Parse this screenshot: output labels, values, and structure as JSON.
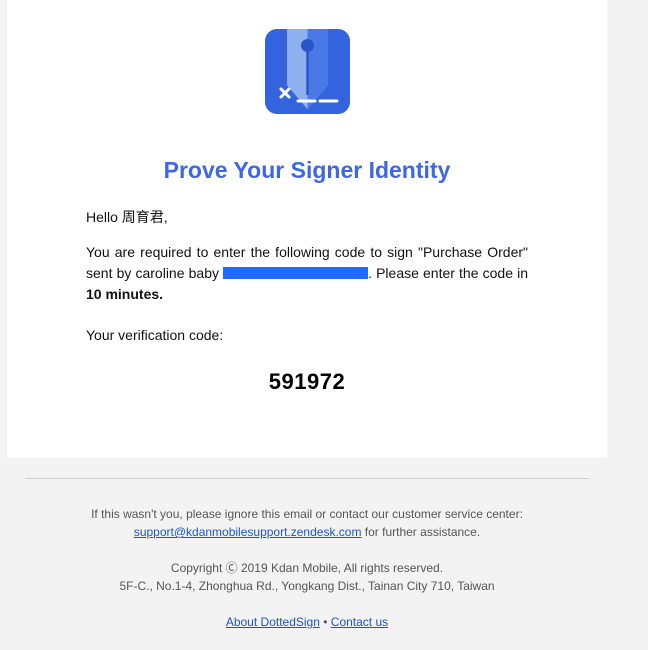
{
  "email": {
    "title": "Prove Your Signer Identity",
    "greeting": "Hello 周育君,",
    "instruction_part1": "You are required to enter the following code to sign \"Purchase Order\" sent by caroline baby ",
    "instruction_part2": " Please enter the code in ",
    "minutes": "10 minutes.",
    "code_label": "Your verification code:",
    "code": "591972"
  },
  "footer": {
    "notice_text": "If this wasn't you, please ignore this email or contact our customer service center:",
    "support_email": "support@kdanmobilesupport.zendesk.com",
    "notice_suffix": " for further assistance.",
    "copyright": "Copyright Ⓒ 2019 Kdan Mobile, All rights reserved.",
    "address": "5F-C., No.1-4, Zhonghua Rd., Yongkang Dist., Tainan City 710, Taiwan",
    "about_link": "About DottedSign",
    "separator": " • ",
    "contact_link": "Contact us"
  },
  "colors": {
    "brand_blue": "#3d67e3",
    "link_blue": "#1a55cc",
    "redaction_blue": "#1f6bff"
  },
  "icons": {
    "logo": "dottedsign-pen-nib-icon"
  }
}
